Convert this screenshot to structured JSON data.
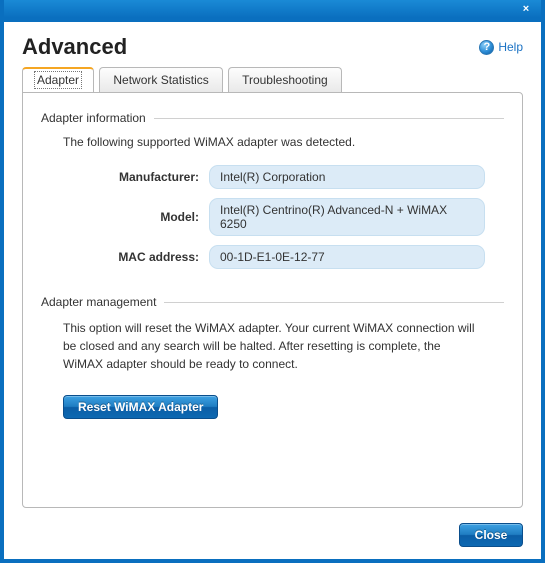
{
  "window": {
    "title": "Advanced",
    "help": "Help"
  },
  "tabs": {
    "adapter": "Adapter",
    "networkStatistics": "Network Statistics",
    "troubleshooting": "Troubleshooting"
  },
  "adapterInfo": {
    "heading": "Adapter information",
    "intro": "The following supported WiMAX adapter was detected.",
    "labels": {
      "manufacturer": "Manufacturer:",
      "model": "Model:",
      "mac": "MAC address:"
    },
    "values": {
      "manufacturer": "Intel(R) Corporation",
      "model": "Intel(R) Centrino(R) Advanced-N + WiMAX 6250",
      "mac": "00-1D-E1-0E-12-77"
    }
  },
  "adapterMgmt": {
    "heading": "Adapter management",
    "desc": "This option will reset the WiMAX adapter. Your current WiMAX connection will be closed and any search will be halted. After resetting is complete, the WiMAX adapter should be ready to connect.",
    "button": "Reset WiMAX Adapter"
  },
  "footer": {
    "close": "Close"
  }
}
